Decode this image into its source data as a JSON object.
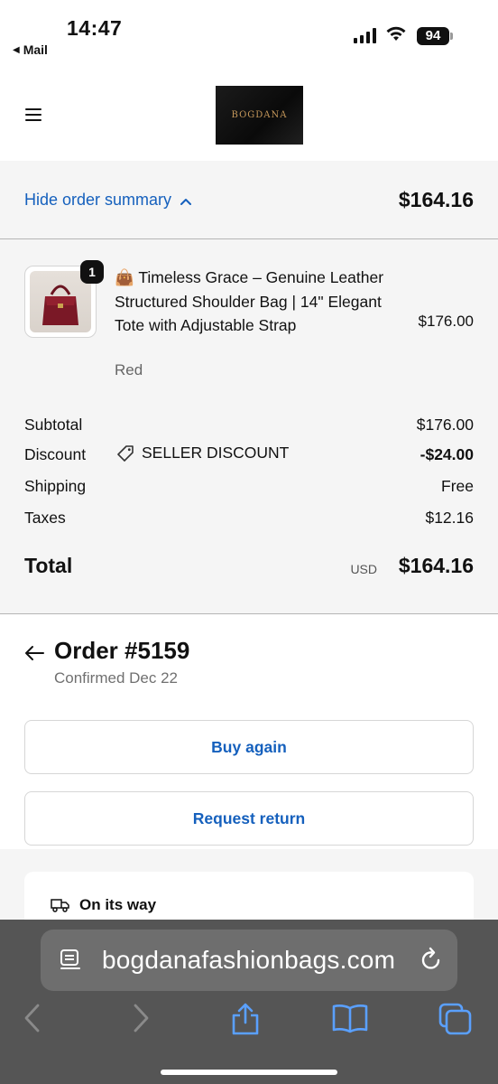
{
  "status_bar": {
    "time": "14:47",
    "back_app": "Mail",
    "battery": "94"
  },
  "header": {
    "logo_text": "BOGDANA"
  },
  "order_summary": {
    "toggle_label": "Hide order summary",
    "total_top": "$164.16",
    "item": {
      "quantity": "1",
      "title": "👜 Timeless Grace – Genuine Leather Structured Shoulder Bag | 14\" Elegant Tote with Adjustable Strap",
      "variant": "Red",
      "price": "$176.00"
    },
    "subtotal_label": "Subtotal",
    "subtotal_value": "$176.00",
    "discount_label": "Discount",
    "discount_code": "SELLER DISCOUNT",
    "discount_value": "-$24.00",
    "shipping_label": "Shipping",
    "shipping_value": "Free",
    "taxes_label": "Taxes",
    "taxes_value": "$12.16",
    "total_label": "Total",
    "total_currency": "USD",
    "total_value": "$164.16"
  },
  "order": {
    "title": "Order #5159",
    "subtitle": "Confirmed Dec 22",
    "buy_again": "Buy again",
    "request_return": "Request return",
    "shipment_status": "On its way"
  },
  "browser": {
    "url": "bogdanafashionbags.com"
  },
  "colors": {
    "link": "#1560bd",
    "summary_bg": "#f5f5f5",
    "toolbar_bg": "#555555"
  }
}
